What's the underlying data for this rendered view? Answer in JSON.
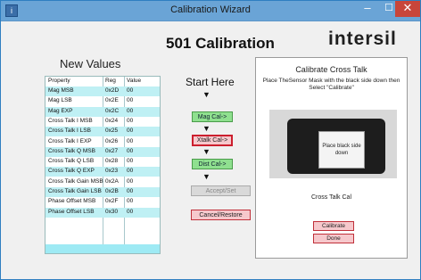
{
  "window": {
    "title": "Calibration Wizard",
    "icon": "app-icon",
    "min_glyph": "–",
    "max_glyph": "☐",
    "close_glyph": "✕"
  },
  "header": {
    "title": "501 Calibration",
    "logo": "intersil"
  },
  "new_values": {
    "title": "New Values",
    "columns": [
      "Property",
      "Reg",
      "Value"
    ],
    "rows": [
      {
        "property": "Mag MSB",
        "reg": "0x2D",
        "value": "00"
      },
      {
        "property": "Mag LSB",
        "reg": "0x2E",
        "value": "00"
      },
      {
        "property": "Mag EXP",
        "reg": "0x2C",
        "value": "00"
      },
      {
        "property": "Cross Talk I MSB",
        "reg": "0x24",
        "value": "00"
      },
      {
        "property": "Cross Talk I LSB",
        "reg": "0x25",
        "value": "00"
      },
      {
        "property": "Cross Talk I EXP",
        "reg": "0x26",
        "value": "00"
      },
      {
        "property": "Cross Talk Q MSB",
        "reg": "0x27",
        "value": "00"
      },
      {
        "property": "Cross Talk Q LSB",
        "reg": "0x28",
        "value": "00"
      },
      {
        "property": "Cross Talk Q EXP",
        "reg": "0x23",
        "value": "00"
      },
      {
        "property": "Cross Talk Gain MSB",
        "reg": "0x2A",
        "value": "00"
      },
      {
        "property": "Cross Talk Gain LSB",
        "reg": "0x2B",
        "value": "00"
      },
      {
        "property": "Phase Offset MSB",
        "reg": "0x2F",
        "value": "00"
      },
      {
        "property": "Phase Offset LSB",
        "reg": "0x30",
        "value": "00"
      }
    ]
  },
  "steps": {
    "title": "Start Here",
    "arrow": "▼",
    "mag_cal": "Mag Cal->",
    "xtalk_cal": "Xtalk Cal->",
    "dist_cal": "Dist Cal->",
    "accept_set": "Accept/Set",
    "cancel_restore": "Cancel/Restore"
  },
  "panel": {
    "title": "Calibrate Cross Talk",
    "instructions": "Place TheSensor Mask with the black side down then Select \"Calibrate\"",
    "photo_text": "Place black side down",
    "label": "Cross Talk Cal",
    "calibrate": "Calibrate",
    "done": "Done"
  }
}
